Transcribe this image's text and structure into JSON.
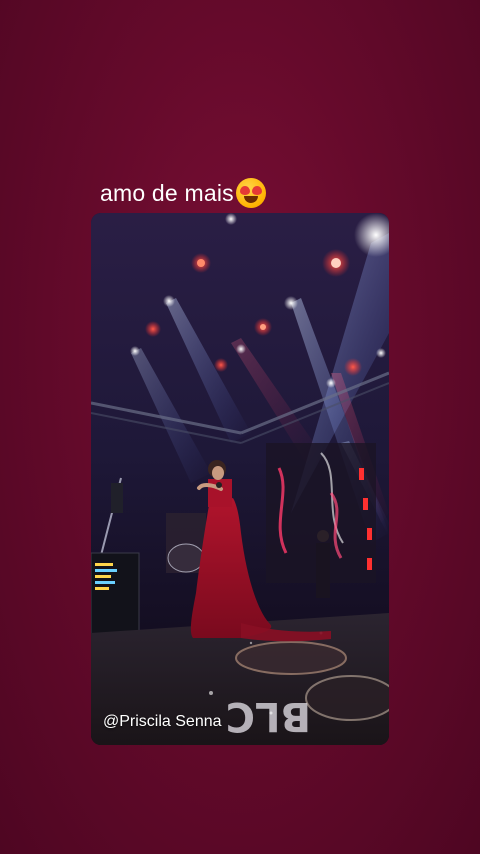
{
  "story": {
    "caption": "amo de mais",
    "caption_emoji_icon": "heart-eyes-emoji-icon",
    "credit": "@Priscila Senna"
  },
  "colors": {
    "background": "#650a2b",
    "text": "#ffffff"
  },
  "media": {
    "description_icon": "concert-stage-photo"
  }
}
